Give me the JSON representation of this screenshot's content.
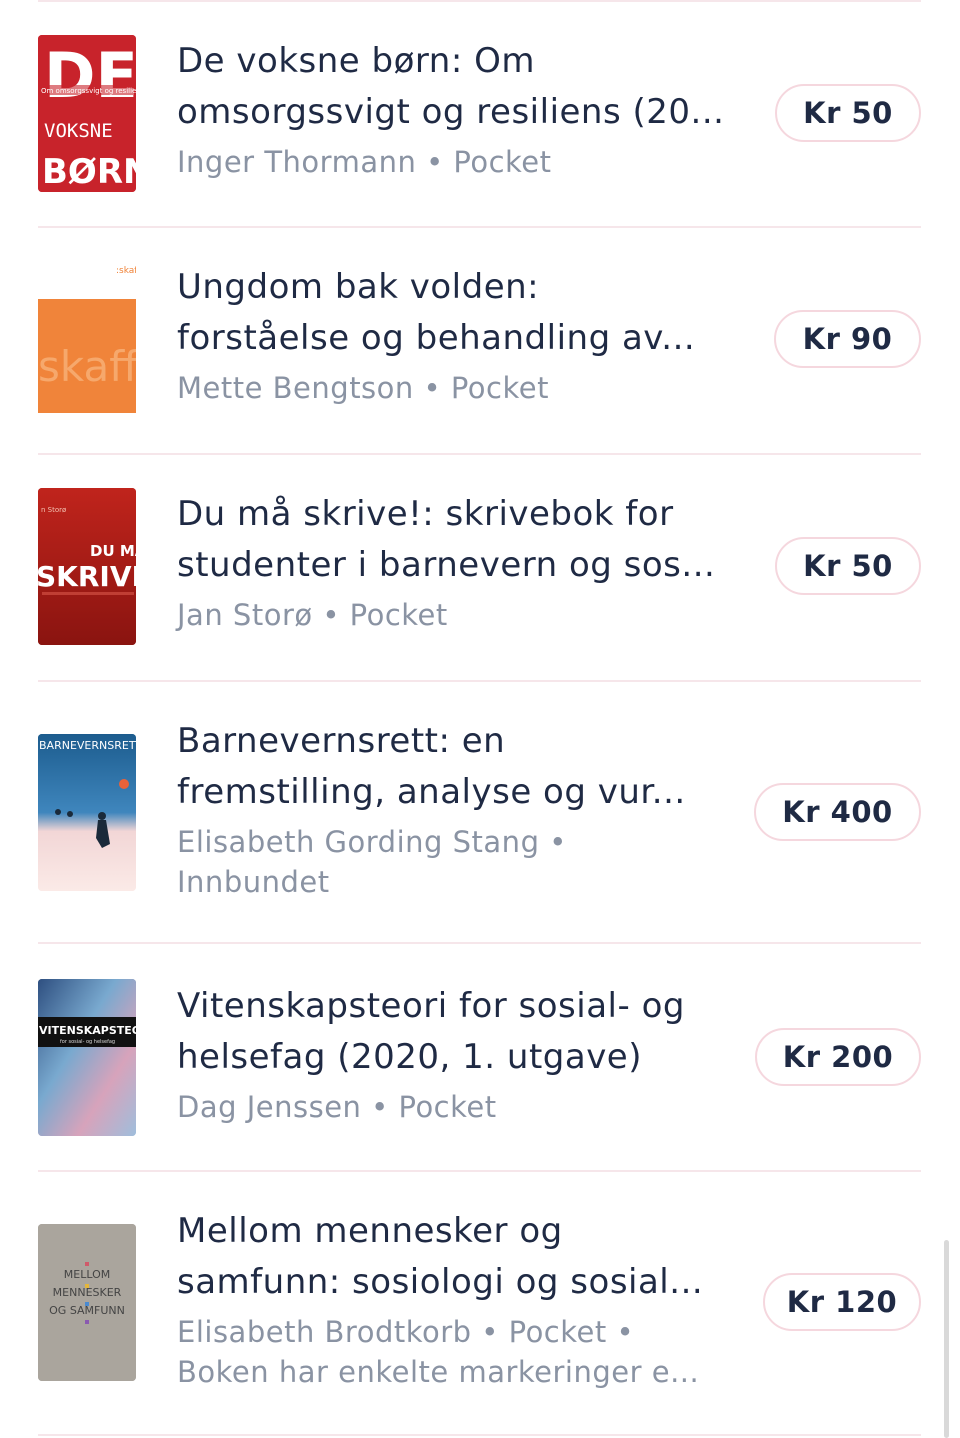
{
  "books": [
    {
      "title": "De voksne børn: Om omsorgssvigt og resiliens (20...",
      "title_line1": "De voksne børn: Om",
      "title_line2": "omsorgssvigt og resiliens (20...",
      "author": "Inger Thormann",
      "format": "Pocket",
      "meta": "Inger Thormann • Pocket",
      "price": "Kr 50",
      "cover_icon": "book-cover-de-voksne-born",
      "cover_text": [
        "DE",
        "VOKSNE",
        "BØRN"
      ]
    },
    {
      "title_line1": "Ungdom bak volden:",
      "title_line2": "forståelse og behandling av...",
      "meta": "Mette Bengtson • Pocket",
      "price": "Kr 90",
      "cover_icon": "book-cover-ungdom-bak-volden",
      "cover_text": [
        "skaff"
      ]
    },
    {
      "title_line1": "Du må skrive!: skrivebok for",
      "title_line2": "studenter i barnevern og sos...",
      "meta": "Jan Storø • Pocket",
      "price": "Kr 50",
      "cover_icon": "book-cover-du-ma-skrive",
      "cover_text": [
        "DU MÅ",
        "SKRIVE"
      ]
    },
    {
      "title_line1": "Barnevernsrett: en",
      "title_line2": "fremstilling, analyse og vur...",
      "meta_line1": "Elisabeth Gording Stang •",
      "meta_line2": "Innbundet",
      "price": "Kr 400",
      "cover_icon": "book-cover-barnevernsrett",
      "cover_text": [
        "BARNEVERNSRETT"
      ]
    },
    {
      "title_line1": "Vitenskapsteori for sosial- og",
      "title_line2": "helsefag (2020, 1. utgave)",
      "meta": "Dag Jenssen • Pocket",
      "price": "Kr 200",
      "cover_icon": "book-cover-vitenskapsteori",
      "cover_text": [
        "VITENSKAPSTEORI"
      ]
    },
    {
      "title_line1": "Mellom mennesker og",
      "title_line2": "samfunn: sosiologi og sosial...",
      "meta_line1": "Elisabeth Brodtkorb • Pocket •",
      "meta_line2": "Boken har enkelte markeringer e...",
      "price": "Kr 120",
      "cover_icon": "book-cover-mellom-mennesker",
      "cover_text": [
        "MELLOM",
        "MENNESKER",
        "OG SAMFUNN"
      ]
    }
  ],
  "colors": {
    "title": "#1f2a44",
    "meta": "#8a93a3",
    "price_border": "#f5d7de",
    "divider": "#f6e6ea"
  }
}
